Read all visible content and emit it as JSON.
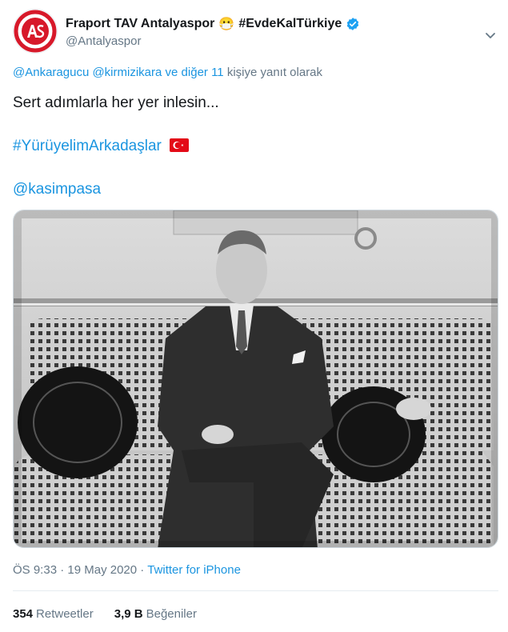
{
  "account": {
    "display_name": "Fraport TAV Antalyaspor",
    "emoji": "😷",
    "hashtag_in_name": "#EvdeKalTürkiye",
    "handle": "@Antalyaspor",
    "verified_icon": "verified-badge-icon",
    "logo_text": "ANTALYASPOR"
  },
  "reply": {
    "mention_1": "@Ankaragucu",
    "mention_2": "@kirmizikara",
    "connector": "ve",
    "others": "diğer 11",
    "suffix": "kişiye yanıt olarak"
  },
  "tweet": {
    "line_1": "Sert adımlarla her yer inlesin...",
    "hashtag": "#YürüyelimArkadaşlar",
    "flag": "🇹🇷",
    "mention": "@kasimpasa"
  },
  "meta": {
    "time": "ÖS 9:33",
    "date": "19 May 2020",
    "separator": "·",
    "source": "Twitter for iPhone"
  },
  "stats": {
    "retweets_count": "354",
    "retweets_label": "Retweetler",
    "likes_count": "3,9 B",
    "likes_label": "Beğeniler"
  },
  "colors": {
    "link": "#1b95e0",
    "secondary_text": "#657786",
    "logo_red": "#d7192a"
  }
}
